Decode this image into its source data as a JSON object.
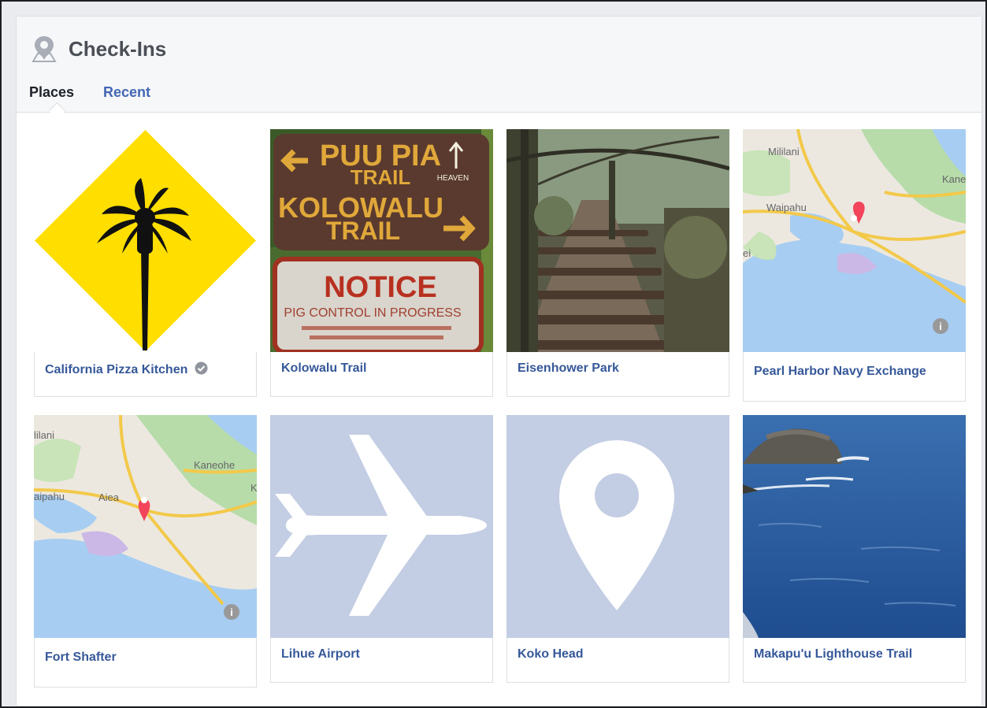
{
  "section": {
    "title": "Check-Ins",
    "tabs": [
      {
        "label": "Places",
        "active": true
      },
      {
        "label": "Recent",
        "active": false
      }
    ]
  },
  "places": [
    {
      "name": "California Pizza Kitchen",
      "thumb": "palm-tree-logo",
      "verified": true
    },
    {
      "name": "Kolowalu Trail",
      "thumb": "trail-sign-photo"
    },
    {
      "name": "Eisenhower Park",
      "thumb": "forest-steps-photo"
    },
    {
      "name": "Pearl Harbor Navy Exchange",
      "thumb": "map",
      "map_labels": [
        "Mililani",
        "Kane",
        "Waipahu",
        "ei"
      ]
    },
    {
      "name": "Fort Shafter",
      "thumb": "map",
      "map_labels": [
        "lilani",
        "Kaneohe",
        "aipahu",
        "Aiea",
        "K"
      ]
    },
    {
      "name": "Lihue Airport",
      "thumb": "airplane-icon"
    },
    {
      "name": "Koko Head",
      "thumb": "map-pin-icon"
    },
    {
      "name": "Makapu'u Lighthouse Trail",
      "thumb": "ocean-cliff-photo"
    }
  ],
  "colors": {
    "link": "#365899",
    "tab_active": "#1d2129",
    "tab_inactive": "#4267b2",
    "placeholder_bg": "#c3cde3",
    "map_pin": "#f2445a",
    "logo_yellow": "#ffde00"
  }
}
